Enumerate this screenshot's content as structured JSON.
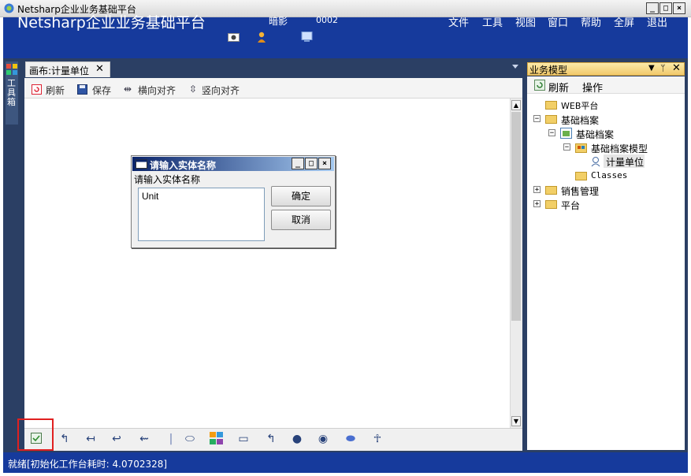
{
  "window": {
    "title": "Netsharp企业业务基础平台",
    "controls": [
      "_",
      "□",
      "×"
    ]
  },
  "header": {
    "app_title": "Netsharp企业业务基础平台",
    "user": "暗影",
    "code": "0002",
    "menu": [
      "文件",
      "工具",
      "视图",
      "窗口",
      "帮助",
      "全屏",
      "退出"
    ]
  },
  "left_dock": {
    "label": "工具箱"
  },
  "document": {
    "tab_label": "画布:计量单位",
    "toolbar": {
      "refresh": "刷新",
      "save": "保存",
      "align_h": "横向对齐",
      "align_v": "竖向对齐"
    }
  },
  "dialog": {
    "title": "请输入实体名称",
    "prompt": "请输入实体名称",
    "value": "Unit",
    "ok": "确定",
    "cancel": "取消"
  },
  "right_panel": {
    "title": "业务模型",
    "toolbar": {
      "refresh": "刷新",
      "actions": "操作"
    },
    "tree": {
      "web": "WEB平台",
      "base": "基础档案",
      "base_child": "基础档案",
      "model": "基础档案模型",
      "unit": "计量单位",
      "classes": "Classes",
      "sales": "销售管理",
      "platform": "平台"
    }
  },
  "status": {
    "text": "就绪[初始化工作台耗时: 4.0702328]"
  },
  "colors": {
    "header": "#163a9c",
    "dock": "#2b3f64",
    "highlight": "#e02020"
  }
}
